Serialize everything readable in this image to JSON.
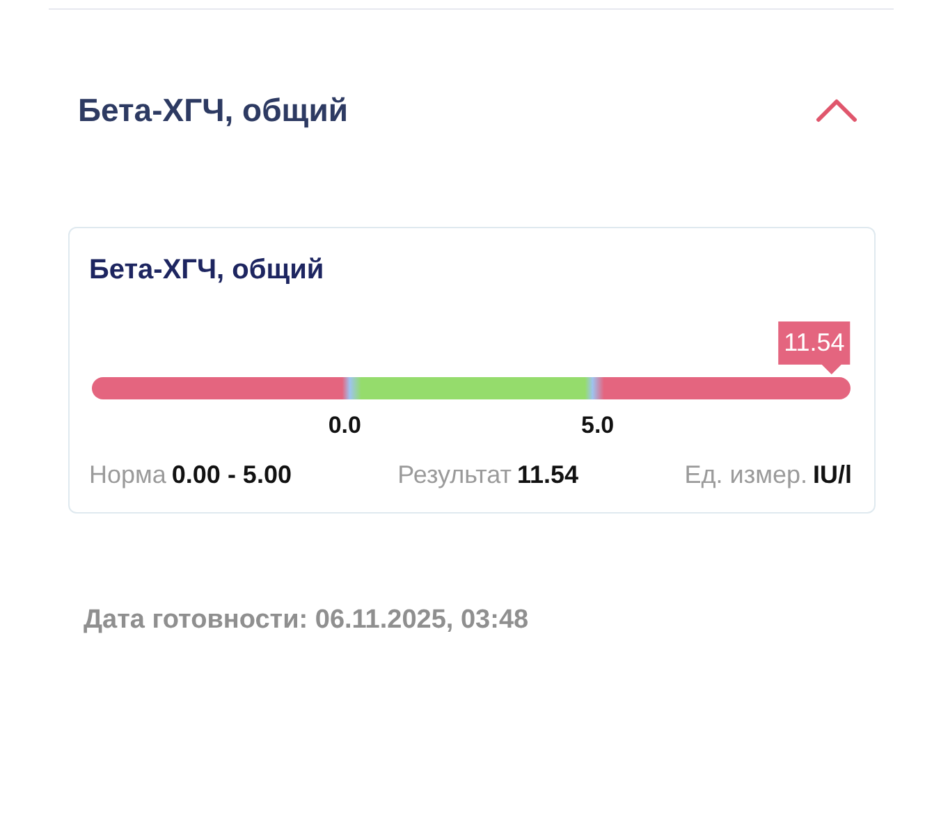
{
  "section": {
    "title": "Бета-ХГЧ, общий",
    "expanded": true
  },
  "card": {
    "title": "Бета-ХГЧ, общий",
    "marker": {
      "label": "11.54",
      "level": 0.975
    },
    "ticks": [
      "0.0",
      "5.0"
    ],
    "stats": [
      {
        "label": "Норма",
        "value": "0.00 - 5.00"
      },
      {
        "label": "Результат",
        "value": "11.54"
      },
      {
        "label": "Ед. измер.",
        "value": "IU/l"
      }
    ]
  },
  "ready_date": "Дата готовности: 06.11.2025, 03:48"
}
